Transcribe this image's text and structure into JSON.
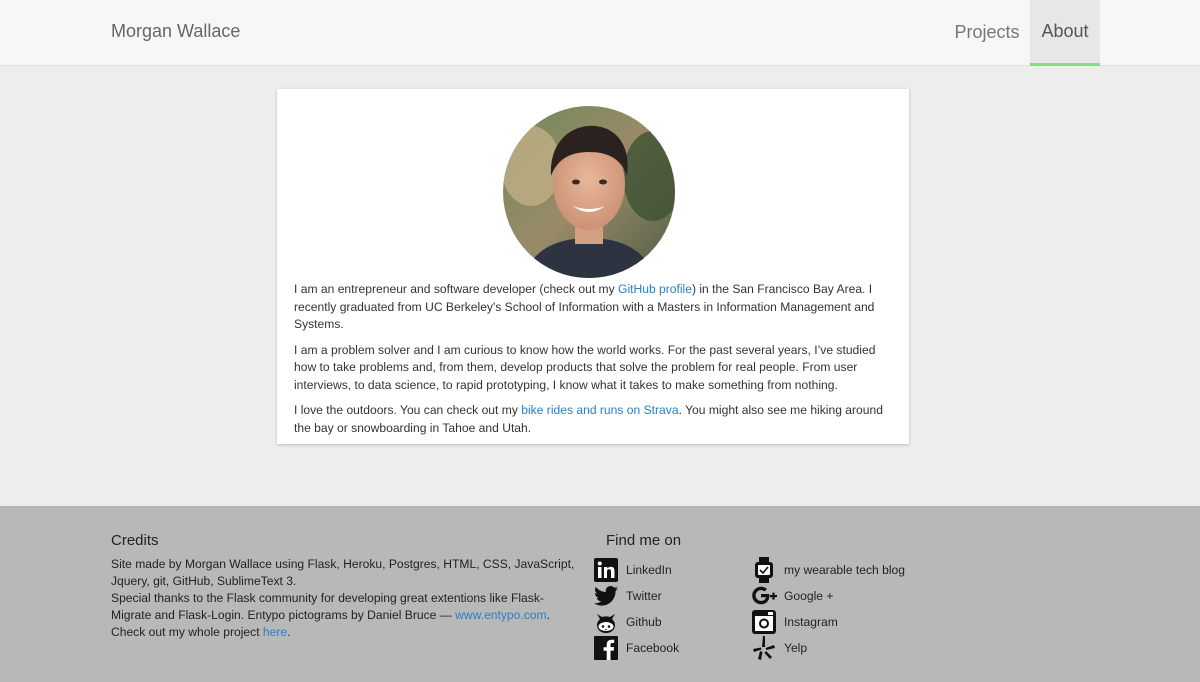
{
  "nav": {
    "brand": "Morgan Wallace",
    "items": [
      {
        "label": "Projects",
        "active": false
      },
      {
        "label": "About",
        "active": true
      }
    ],
    "active_underline_color": "#7be37e"
  },
  "about": {
    "avatar_icon": "profile-photo",
    "p1_before": "I am an entrepreneur and software developer (check out my ",
    "p1_link": "GitHub profile",
    "p1_after": ") in the San Francisco Bay Area. I recently graduated from UC Berkeley's School of Information with a Masters in Information Management and Systems.",
    "p2": "I am a problem solver and I am curious to know how the world works. For the past several years, I’ve studied how to take problems and, from them, develop products that solve the problem for real people. From user interviews, to data science, to rapid prototyping, I know what it takes to make something from nothing.",
    "p3_before": "I love the outdoors. You can check out my ",
    "p3_link": "bike rides and runs on Strava",
    "p3_after": ". You might also see me hiking around the bay or snowboarding in Tahoe and Utah."
  },
  "footer": {
    "credits_title": "Credits",
    "credits_line1": "Site made by Morgan Wallace using Flask, Heroku, Postgres, HTML, CSS, JavaScript, Jquery, git, GitHub, SublimeText 3.",
    "credits_line2_before": "Special thanks to the Flask community for developing great extentions like Flask-Migrate and Flask-Login. Entypo pictograms by Daniel Bruce — ",
    "credits_line2_link": "www.entypo.com",
    "credits_line2_after": ".",
    "credits_line3_before": "Check out my whole project ",
    "credits_line3_link": "here",
    "credits_line3_after": ".",
    "find_title": "Find me on",
    "links": [
      {
        "label": "LinkedIn",
        "icon": "linkedin-icon"
      },
      {
        "label": "Twitter",
        "icon": "twitter-icon"
      },
      {
        "label": "Github",
        "icon": "github-icon"
      },
      {
        "label": "Facebook",
        "icon": "facebook-icon"
      },
      {
        "label": "my wearable tech blog",
        "icon": "watch-icon"
      },
      {
        "label": "Google +",
        "icon": "google-plus-icon"
      },
      {
        "label": "Instagram",
        "icon": "instagram-icon"
      },
      {
        "label": "Yelp",
        "icon": "yelp-icon"
      }
    ]
  },
  "colors": {
    "link": "#2a7ec6",
    "footer_bg": "#b8b8b8",
    "page_bg": "#ededed"
  }
}
